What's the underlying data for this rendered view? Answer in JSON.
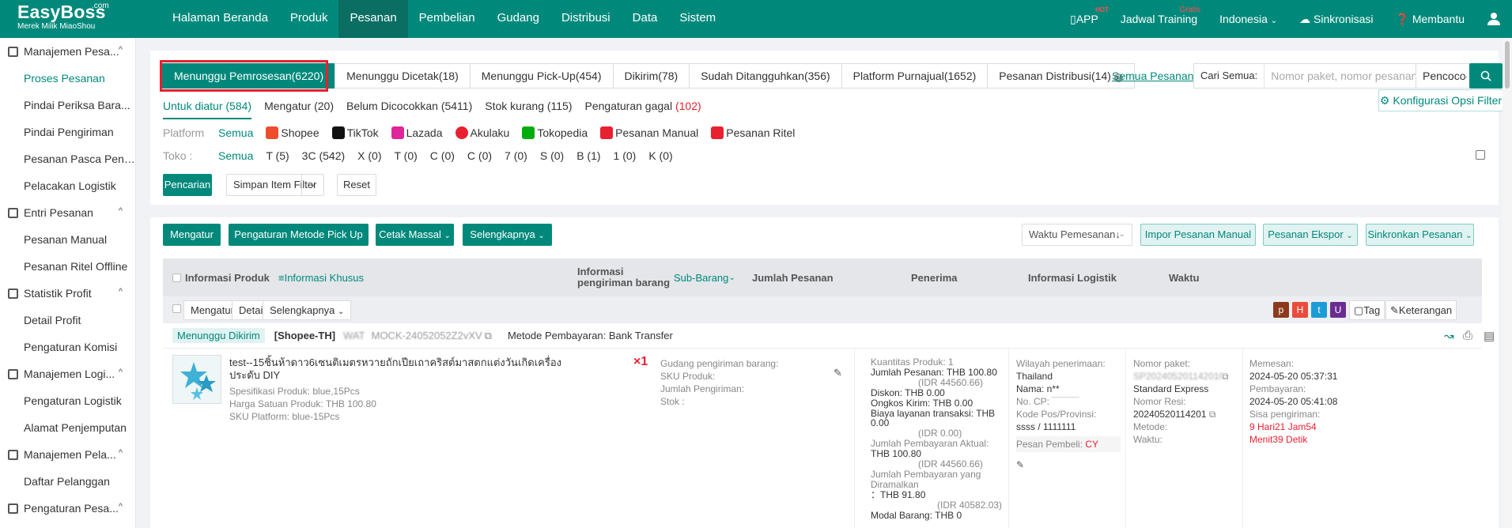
{
  "app": {
    "logo": "EasyBoss",
    "logo_com": ".com",
    "logo_sub": "Merek Milik MiaoShou"
  },
  "nav": [
    "Halaman Beranda",
    "Produk",
    "Pesanan",
    "Pembelian",
    "Gudang",
    "Distribusi",
    "Data",
    "Sistem"
  ],
  "topright": {
    "app": "APP",
    "hot": "HOT",
    "training": "Jadwal Training",
    "gratis": "Gratis",
    "language": "Indonesia",
    "sync": "Sinkronisasi",
    "help": "Membantu"
  },
  "sidebar": [
    {
      "title": "Manajemen Pesa...",
      "items": [
        {
          "label": "Proses Pesanan"
        },
        {
          "label": "Pindai Periksa Bara..."
        },
        {
          "label": "Pindai Pengiriman"
        },
        {
          "label": "Pesanan Pasca Penj..."
        },
        {
          "label": "Pelacakan Logistik"
        }
      ]
    },
    {
      "title": "Entri Pesanan",
      "items": [
        {
          "label": "Pesanan Manual"
        },
        {
          "label": "Pesanan Ritel Offline"
        }
      ]
    },
    {
      "title": "Statistik Profit",
      "items": [
        {
          "label": "Detail Profit"
        },
        {
          "label": "Pengaturan Komisi"
        }
      ]
    },
    {
      "title": "Manajemen Logi...",
      "items": [
        {
          "label": "Pengaturan Logistik"
        },
        {
          "label": "Alamat Penjemputan"
        }
      ]
    },
    {
      "title": "Manajemen Pela...",
      "items": [
        {
          "label": "Daftar Pelanggan"
        }
      ]
    },
    {
      "title": "Pengaturan Pesa...",
      "items": []
    }
  ],
  "tabs": [
    "Menunggu Pemrosesan(6220)",
    "Menunggu Dicetak(18)",
    "Menunggu Pick-Up(454)",
    "Dikirim(78)",
    "Sudah Ditangguhkan(356)",
    "Platform Purnajual(1652)",
    "Pesanan Distribusi(14)"
  ],
  "all_orders": "Semua Pesanan",
  "search": {
    "label": "Cari Semua:",
    "placeholder": "Nomor paket, nomor pesanan",
    "match": "Pencoco"
  },
  "config_btn": "Konfigurasi Opsi Filter",
  "subtabs": [
    "Untuk diatur (584)",
    "Mengatur (20)",
    "Belum Dicocokkan (5411)",
    "Stok kurang (115)"
  ],
  "subtab_failed_label": "Pengaturan gagal",
  "subtab_failed_count": "(102)",
  "platform": {
    "label": "Platform",
    "options": [
      "Semua",
      "Shopee",
      "TikTok",
      "Lazada",
      "Akulaku",
      "Tokopedia",
      "Pesanan Manual",
      "Pesanan Ritel"
    ],
    "colors": [
      "#ee4d2d",
      "#111111",
      "#e0249a",
      "#e8202f",
      "#03ac0e",
      "#e8202f",
      "#e8202f"
    ]
  },
  "toko": {
    "label": "Toko",
    "options": [
      "Semua",
      "T (5)",
      "3C (542)",
      "X (0)",
      "T (0)",
      "C (0)",
      "C (0)",
      "7 (0)",
      "S (0)",
      "B (1)",
      "1 (0)",
      "K (0)"
    ]
  },
  "filter_buttons": {
    "search": "Pencarian",
    "save": "Simpan Item Filter",
    "reset": "Reset"
  },
  "actions": {
    "arrange": "Mengatur",
    "pickup": "Pengaturan Metode Pick Up",
    "print": "Cetak Massal",
    "more": "Selengkapnya",
    "sort": "Waktu Pemesanan",
    "import": "Impor Pesanan Manual",
    "export": "Pesanan Ekspor",
    "sync": "Sinkronkan Pesanan"
  },
  "table_head": {
    "product": "Informasi Produk",
    "special": "Informasi Khusus",
    "shipping": "Informasi pengiriman barang",
    "subitem": "Sub-Barang",
    "amount": "Jumlah Pesanan",
    "receiver": "Penerima",
    "logistics": "Informasi Logistik",
    "time": "Waktu"
  },
  "batch": {
    "arrange": "Mengatur",
    "detail": "Detail",
    "more": "Selengkapnya",
    "tags": [
      "p",
      "H",
      "t",
      "U"
    ],
    "tag_colors": [
      "#8b3a1e",
      "#e94b3c",
      "#1d9bd7",
      "#6a2c91"
    ],
    "tag": "Tag",
    "note": "Keterangan"
  },
  "order": {
    "status": "Menunggu Dikirim",
    "shop": "[Shopee-TH]",
    "shop_blur": "WAT",
    "order_no": "MOCK-24052052Z2vXV",
    "payment": "Metode Pembayaran: Bank Transfer",
    "product": {
      "title": "test--15ชิ้นห้าดาว6เซนติเมตรหวายถักเปียเถาคริสต์มาสตกแต่งวันเกิดเครื่องประดับ DIY",
      "spec": "Spesifikasi Produk:  blue,15Pcs",
      "price": "Harga Satuan Produk:  THB 100.80",
      "sku": "SKU Platform:  blue-15Pcs",
      "qty": "×1"
    },
    "shipping": {
      "warehouse": "Gudang pengiriman barang:",
      "sku": "SKU Produk:",
      "qty": "Jumlah Pengiriman:",
      "stock": "Stok       :"
    },
    "amount": {
      "lines": [
        "Kuantitas Produk:  1",
        "Jumlah Pesanan:  THB 100.80",
        "(IDR 44560.66)",
        "Diskon:  THB 0.00",
        "Ongkos Kirim:  THB 0.00",
        "Biaya layanan transaksi:  THB 0.00",
        "(IDR 0.00)",
        "Jumlah Pembayaran Aktual:",
        "THB 100.80",
        "(IDR 44560.66)",
        "Jumlah Pembayaran yang Diramalkan",
        "：THB 91.80",
        "(IDR 40582.03)",
        "Modal Barang:  THB 0"
      ]
    },
    "receiver": {
      "region_label": "Wilayah penerimaan:",
      "region": "Thailand",
      "name": "Nama:  n**",
      "phone": "No. CP:",
      "postal_label": "Kode Pos/Provinsi:",
      "postal": "ssss / 1111111",
      "buyer_label": "Pesan Pembeli:",
      "buyer": "CY"
    },
    "logistics": {
      "package_label": "Nomor paket:",
      "package_blur": "SP2024052011420100001",
      "service": "Standard Express",
      "resi_label": "Nomor Resi:",
      "resi": "20240520114201",
      "method": "Metode:",
      "time": "Waktu:"
    },
    "time": {
      "order_label": "Memesan:",
      "order": "2024-05-20 05:37:31",
      "pay_label": "Pembayaran:",
      "pay": "2024-05-20 05:41:08",
      "remaining_label": "Sisa pengiriman:",
      "remaining": "9 Hari21 Jam54 Menit39 Detik"
    }
  }
}
